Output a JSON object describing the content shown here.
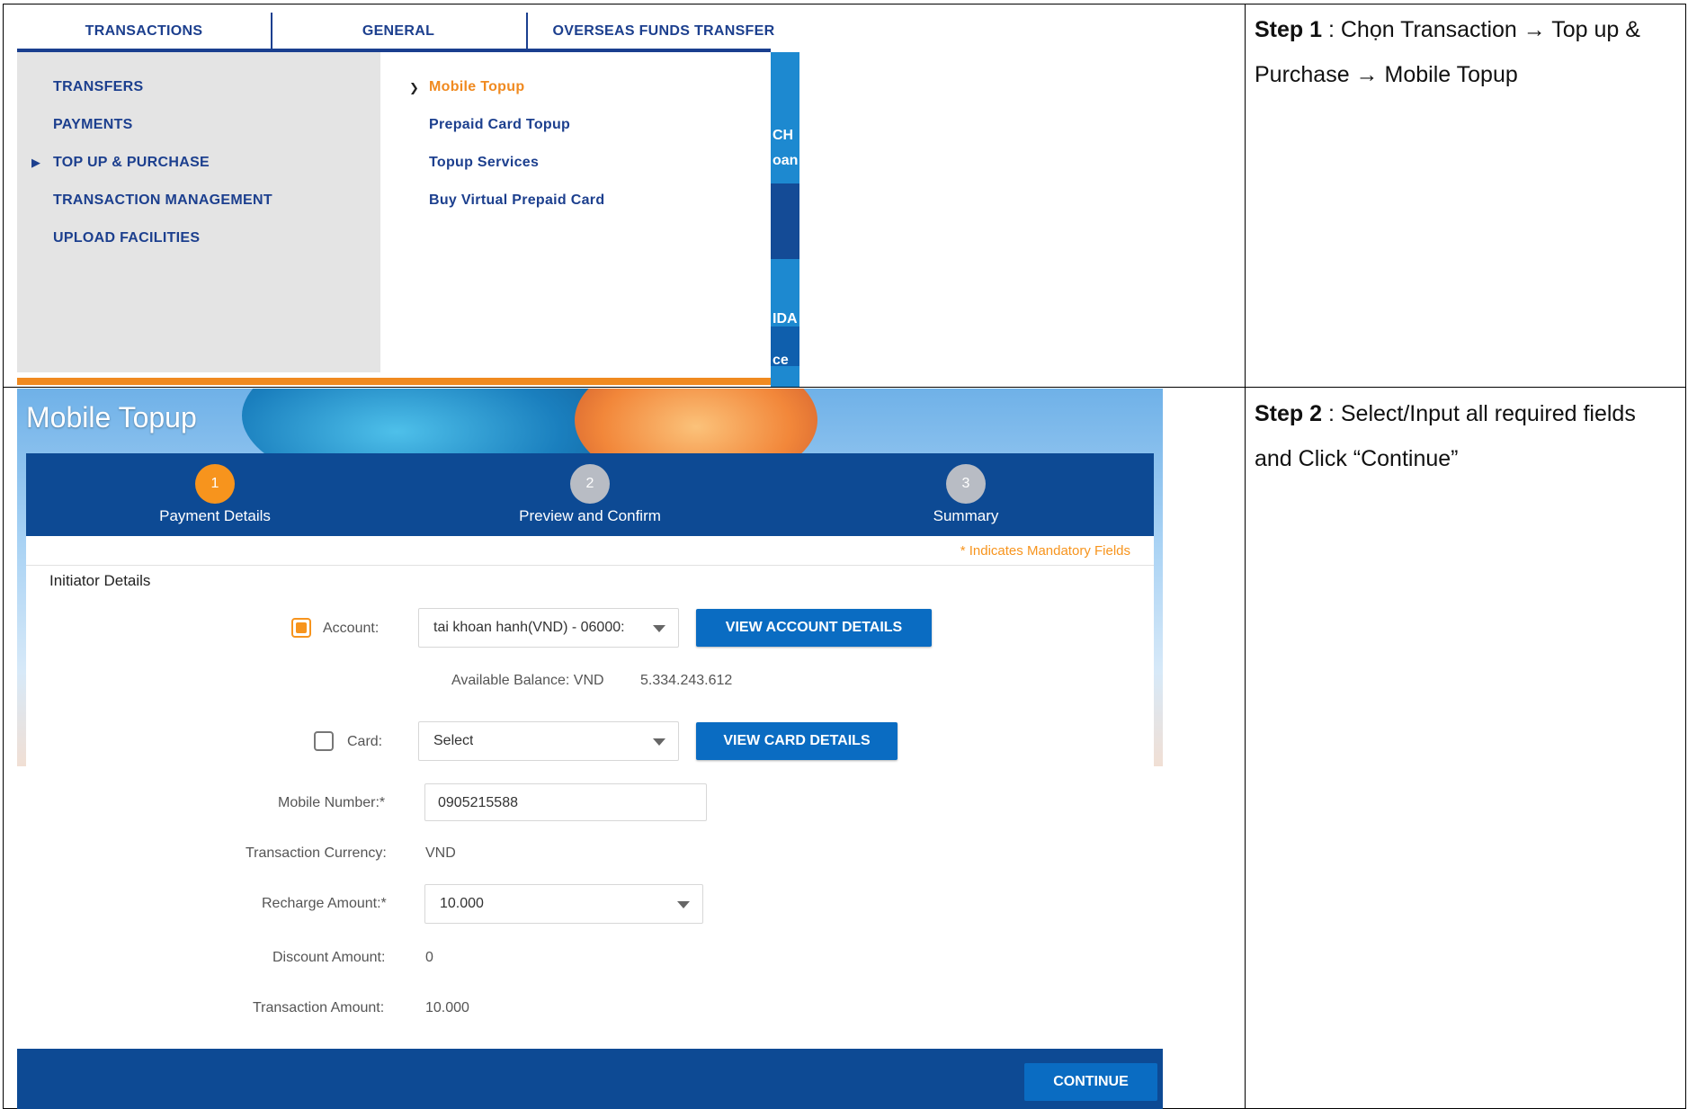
{
  "step1": {
    "label": "Step 1",
    "text": " : Chọn Transaction → Top up & Purchase  → Mobile Topup"
  },
  "step2": {
    "label": "Step 2",
    "text": " : Select/Input all required fields and Click “Continue”"
  },
  "menu": {
    "tabs": [
      "TRANSACTIONS",
      "GENERAL",
      "OVERSEAS FUNDS TRANSFER"
    ],
    "left_items": [
      "TRANSFERS",
      "PAYMENTS",
      "TOP UP & PURCHASE",
      "TRANSACTION MANAGEMENT",
      "UPLOAD FACILITIES"
    ],
    "right_items": [
      "Mobile Topup",
      "Prepaid Card Topup",
      "Topup Services",
      "Buy Virtual Prepaid Card"
    ],
    "edge_fragments": [
      "CH",
      "oan",
      "IDA",
      "ce"
    ],
    "colors": {
      "navy": "#1c3f8e",
      "orange": "#f08a20"
    }
  },
  "topup": {
    "title": "Mobile Topup",
    "steps": [
      {
        "num": "1",
        "label": "Payment Details"
      },
      {
        "num": "2",
        "label": "Preview and Confirm"
      },
      {
        "num": "3",
        "label": "Summary"
      }
    ],
    "mandatory_note": "* Indicates Mandatory Fields",
    "section_title": "Initiator Details",
    "account_label": "Account:",
    "account_value": "tai khoan hanh(VND)  - 06000:",
    "view_account_btn": "VIEW ACCOUNT DETAILS",
    "balance_label": "Available Balance: VND",
    "balance_value": "5.334.243.612",
    "card_label": "Card:",
    "card_value": "Select",
    "view_card_btn": "VIEW CARD DETAILS",
    "mobile_label": "Mobile Number:*",
    "mobile_value": "0905215588",
    "currency_label": "Transaction Currency:",
    "currency_value": "VND",
    "recharge_label": "Recharge Amount:*",
    "recharge_value": "10.000",
    "discount_label": "Discount Amount:",
    "discount_value": "0",
    "txn_amount_label": "Transaction Amount:",
    "txn_amount_value": "10.000",
    "continue_btn": "CONTINUE",
    "colors": {
      "navy": "#0d4a94",
      "button": "#0a6cc2",
      "accent": "#f7941d"
    }
  }
}
